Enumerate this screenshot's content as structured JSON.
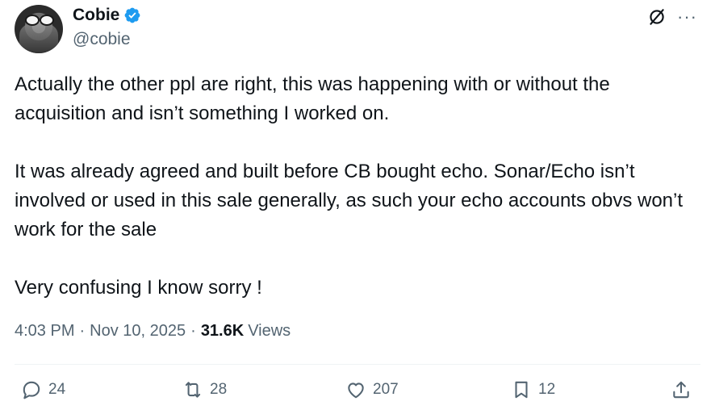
{
  "author": {
    "name": "Cobie",
    "handle": "@cobie",
    "verified": true
  },
  "icons": {
    "verified": "verified-badge-icon",
    "grok": "grok-icon",
    "more": "more-icon"
  },
  "more_label": "···",
  "body": [
    "Actually the other ppl are right, this was happening with or without the acquisition and isn’t something I worked on.",
    "It was already agreed and built before CB bought echo. Sonar/Echo isn’t involved or used in this sale generally, as such your echo accounts obvs won’t work for the sale",
    "Very confusing I know sorry !"
  ],
  "meta": {
    "time": "4:03 PM",
    "separator": "·",
    "date": "Nov 10, 2025",
    "views_count": "31.6K",
    "views_label": "Views"
  },
  "actions": {
    "replies": "24",
    "reposts": "28",
    "likes": "207",
    "bookmarks": "12"
  },
  "colors": {
    "text": "#0f1419",
    "muted": "#536471",
    "verified": "#1d9bf0",
    "divider": "#eff3f4"
  }
}
